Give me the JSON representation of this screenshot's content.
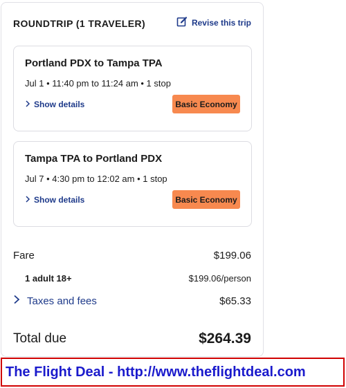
{
  "trip": {
    "heading": "ROUNDTRIP (1 TRAVELER)",
    "revise_label": "Revise this trip"
  },
  "segments": [
    {
      "route": "Portland PDX to Tampa TPA",
      "time": "Jul 1 • 11:40 pm to 11:24 am • 1 stop",
      "details_label": "Show details",
      "fare_class": "Basic Economy"
    },
    {
      "route": "Tampa TPA to Portland PDX",
      "time": "Jul 7 • 4:30 pm to 12:02 am • 1 stop",
      "details_label": "Show details",
      "fare_class": "Basic Economy"
    }
  ],
  "price": {
    "fare_label": "Fare",
    "fare_value": "$199.06",
    "adult_label": "1 adult 18+",
    "adult_value": "$199.06/person",
    "taxes_label": "Taxes and fees",
    "taxes_value": "$65.33",
    "total_label": "Total due",
    "total_value": "$264.39"
  },
  "banner": {
    "text": "The Flight Deal - http://www.theflightdeal.com"
  },
  "colors": {
    "link": "#1e3a8a",
    "badge": "#f7894f",
    "banner_border": "#d00000",
    "banner_text": "#1a1acc"
  },
  "icons": {
    "revise": "edit-icon",
    "details": "chevron-right-icon",
    "taxes": "chevron-right-icon"
  }
}
